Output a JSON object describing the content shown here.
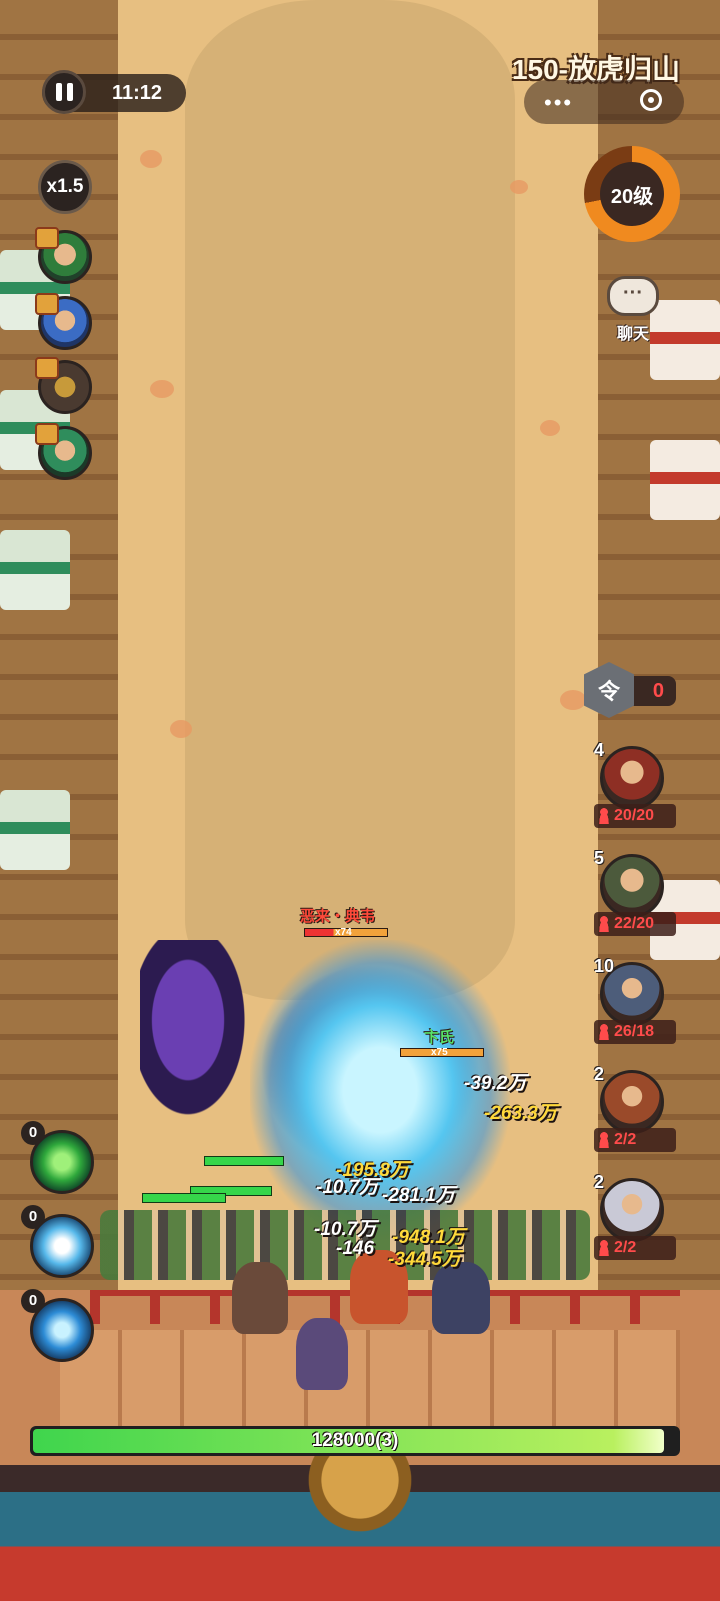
{
  "stage": {
    "title": "150-放虎归山"
  },
  "hud": {
    "timer": "11:12",
    "speed": "x1.5",
    "level": "20级",
    "chat_label": "聊天",
    "token_glyph": "令",
    "token_count": "0",
    "more_dots": "•••"
  },
  "units": [
    {
      "level": "4",
      "count": "20/20",
      "color": "#8e2f24"
    },
    {
      "level": "5",
      "count": "22/20",
      "color": "#4c5a3c"
    },
    {
      "level": "10",
      "count": "26/18",
      "color": "#4d5d7a"
    },
    {
      "level": "2",
      "count": "2/2",
      "color": "#9a4a2a"
    },
    {
      "level": "2",
      "count": "2/2",
      "color": "#c9c9d6"
    }
  ],
  "skills": [
    {
      "count": "0",
      "color": "#2fa83c"
    },
    {
      "count": "0",
      "color": "#56b8ea"
    },
    {
      "count": "0",
      "color": "#2d8cd6"
    }
  ],
  "enemies": [
    {
      "name": "恶来・典韦",
      "multiplier": "x74",
      "name_color": "#ff4a3a"
    },
    {
      "name": "卞氏",
      "multiplier": "x75",
      "name_color": "#59e26b"
    }
  ],
  "damage_numbers": [
    {
      "text": "-39.2万",
      "color": "#ffffff"
    },
    {
      "text": "-263.3万",
      "color": "#ffd93a"
    },
    {
      "text": "-195.8万",
      "color": "#ffd93a"
    },
    {
      "text": "-10.7万",
      "color": "#ffffff"
    },
    {
      "text": "-281.1万",
      "color": "#ffffff"
    },
    {
      "text": "-10.7万",
      "color": "#ffffff"
    },
    {
      "text": "-948.1万",
      "color": "#ffd93a"
    },
    {
      "text": "-146",
      "color": "#ffffff"
    },
    {
      "text": "-344.5万",
      "color": "#ffd93a"
    }
  ],
  "wave": {
    "text": "128000(3)",
    "progress": 0.98
  }
}
